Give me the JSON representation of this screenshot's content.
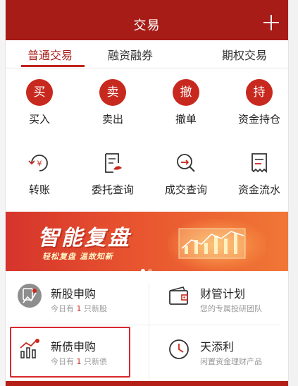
{
  "header": {
    "title": "交易",
    "add_icon": "plus-icon"
  },
  "tabs": [
    {
      "label": "普通交易",
      "active": true
    },
    {
      "label": "融资融券",
      "active": false
    },
    {
      "label": "期权交易",
      "active": false
    }
  ],
  "row1": [
    {
      "glyph": "买",
      "label": "买入"
    },
    {
      "glyph": "卖",
      "label": "卖出"
    },
    {
      "glyph": "撤",
      "label": "撤单"
    },
    {
      "glyph": "持",
      "label": "资金持仓"
    }
  ],
  "row2": [
    {
      "icon": "transfer-yen-icon",
      "label": "转账"
    },
    {
      "icon": "order-query-icon",
      "label": "委托查询"
    },
    {
      "icon": "deal-query-icon",
      "label": "成交查询"
    },
    {
      "icon": "fund-flow-icon",
      "label": "资金流水"
    }
  ],
  "banner": {
    "title": "智能复盘",
    "subtitle": "轻松复盘  温故知新"
  },
  "panel": {
    "new_stock": {
      "title": "新股申购",
      "sub_pre": "今日有 ",
      "count": "1",
      "sub_post": " 只新股"
    },
    "wealth": {
      "title": "财管计划",
      "sub": "您的专属投研团队"
    },
    "new_bond": {
      "title": "新债申购",
      "sub_pre": "今日有 ",
      "count": "1",
      "sub_post": " 只新债"
    },
    "tiantianli": {
      "title": "天添利",
      "sub": "闲置资金理财产品"
    }
  },
  "colors": {
    "brand": "#a71c17",
    "accent": "#c8291f",
    "highlight_box": "#d9282f"
  }
}
